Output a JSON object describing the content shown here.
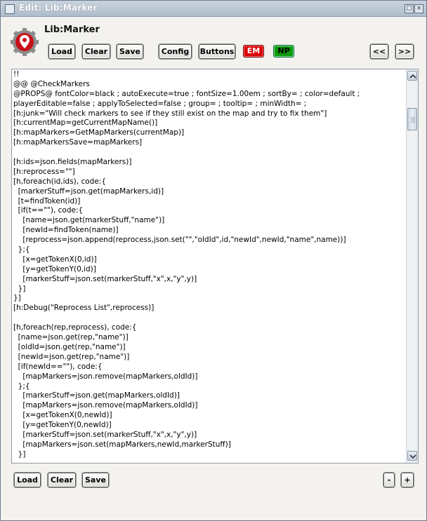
{
  "window": {
    "title": "Edit: Lib:Marker"
  },
  "header": {
    "name": "Lib:Marker"
  },
  "toolbar": {
    "load": "Load",
    "clear": "Clear",
    "save": "Save",
    "config": "Config",
    "buttons": "Buttons",
    "em": "EM",
    "np": "NP",
    "prev": "<<",
    "next": ">>"
  },
  "colors": {
    "em": "#d90000",
    "np": "#0b9a0b",
    "accent": "#aebcca"
  },
  "editor": {
    "lines": [
      "!!",
      "@@ @CheckMarkers",
      "@PROPS@ fontColor=black ; autoExecute=true ; fontSize=1.00em ; sortBy= ; color=default ;",
      "playerEditable=false ; applyToSelected=false ; group= ; tooltip= ; minWidth= ;",
      "[h:junk=\"Will check markers to see if they still exist on the map and try to fix them\"]",
      "[h:currentMap=getCurrentMapName()]",
      "[h:mapMarkers=GetMapMarkers(currentMap)]",
      "[h:mapMarkersSave=mapMarkers]",
      "",
      "[h:ids=json.fields(mapMarkers)]",
      "[h:reprocess=\"\"]",
      "[h,foreach(id,ids), code:{",
      "  [markerStuff=json.get(mapMarkers,id)]",
      "  [t=findToken(id)]",
      "  [if(t==\"\"), code:{",
      "    [name=json.get(markerStuff,\"name\")]",
      "    [newId=findToken(name)]",
      "    [reprocess=json.append(reprocess,json.set(\"\",\"oldId\",id,\"newId\",newId,\"name\",name))]",
      "  };{",
      "    [x=getTokenX(0,id)]",
      "    [y=getTokenY(0,id)]",
      "    [markerStuff=json.set(markerStuff,\"x\",x,\"y\",y)]",
      "  }]",
      "}]",
      "[h:Debug(\"Reprocess List\",reprocess)]",
      "",
      "[h,foreach(rep,reprocess), code:{",
      "  [name=json.get(rep,\"name\")]",
      "  [oldId=json.get(rep,\"name\")]",
      "  [newId=json.get(rep,\"name\")]",
      "  [if(newId==\"\"), code:{",
      "    [mapMarkers=json.remove(mapMarkers,oldId)]",
      "  };{",
      "    [markerStuff=json.get(mapMarkers,oldId)]",
      "    [mapMarkers=json.remove(mapMarkers,oldId)]",
      "    [x=getTokenX(0,newId)]",
      "    [y=getTokenY(0,newId)]",
      "    [markerStuff=json.set(markerStuff,\"x\",x,\"y\",y)]",
      "    [mapMarkers=json.set(mapMarkers,newId,markerStuff)]",
      "  }]"
    ]
  },
  "footer": {
    "load": "Load",
    "clear": "Clear",
    "save": "Save",
    "minus": "-",
    "plus": "+"
  }
}
